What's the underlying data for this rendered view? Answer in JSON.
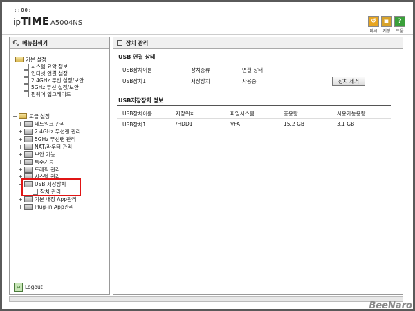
{
  "header": {
    "logo_dots": "::OO:",
    "brand_ip": "ip",
    "brand_time": "TIME",
    "model": "A5004NS",
    "buttons": [
      {
        "label": "마시",
        "icon": "stat-icon",
        "color": "#e7a520"
      },
      {
        "label": "저장",
        "icon": "save-icon",
        "color": "#d8a32a"
      },
      {
        "label": "도움",
        "icon": "help-icon",
        "color": "#3aa03a"
      }
    ]
  },
  "left": {
    "title": "메뉴탐색기",
    "basic": {
      "label": "기본 설정",
      "items": [
        "시스템 요약 정보",
        "인터넷 연결 설정",
        "2.4GHz 무선 설정/보안",
        "5GHz 무선 설정/보안",
        "펌웨어 업그레이드"
      ]
    },
    "advanced": {
      "label": "고급 설정",
      "items": [
        "네트워크 관리",
        "2.4GHz 무선랜 관리",
        "5GHz 무선랜 관리",
        "NAT/라우터 관리",
        "보안 기능",
        "특수기능",
        "트래픽 관리",
        "시스템 관리",
        "USB 저장장치",
        "장치 관리",
        "기본 내장 App관리",
        "Plug-in App관리"
      ]
    },
    "logout": "Logout"
  },
  "right": {
    "title": "장치 관리",
    "usb_status": {
      "title": "USB 연결 상태",
      "headers": [
        "USB장치이름",
        "장치종류",
        "연결 상태"
      ],
      "rows": [
        [
          "USB장치1",
          "저장장치",
          "사용중"
        ]
      ],
      "eject_label": "장치 제거"
    },
    "storage_info": {
      "title": "USB저장장치 정보",
      "headers": [
        "USB장치이름",
        "저장위치",
        "파일시스템",
        "총용량",
        "사용가능용량"
      ],
      "rows": [
        [
          "USB장치1",
          "/HDD1",
          "VFAT",
          "15.2 GB",
          "3.1 GB"
        ]
      ]
    }
  },
  "watermark": "BeeNaro"
}
